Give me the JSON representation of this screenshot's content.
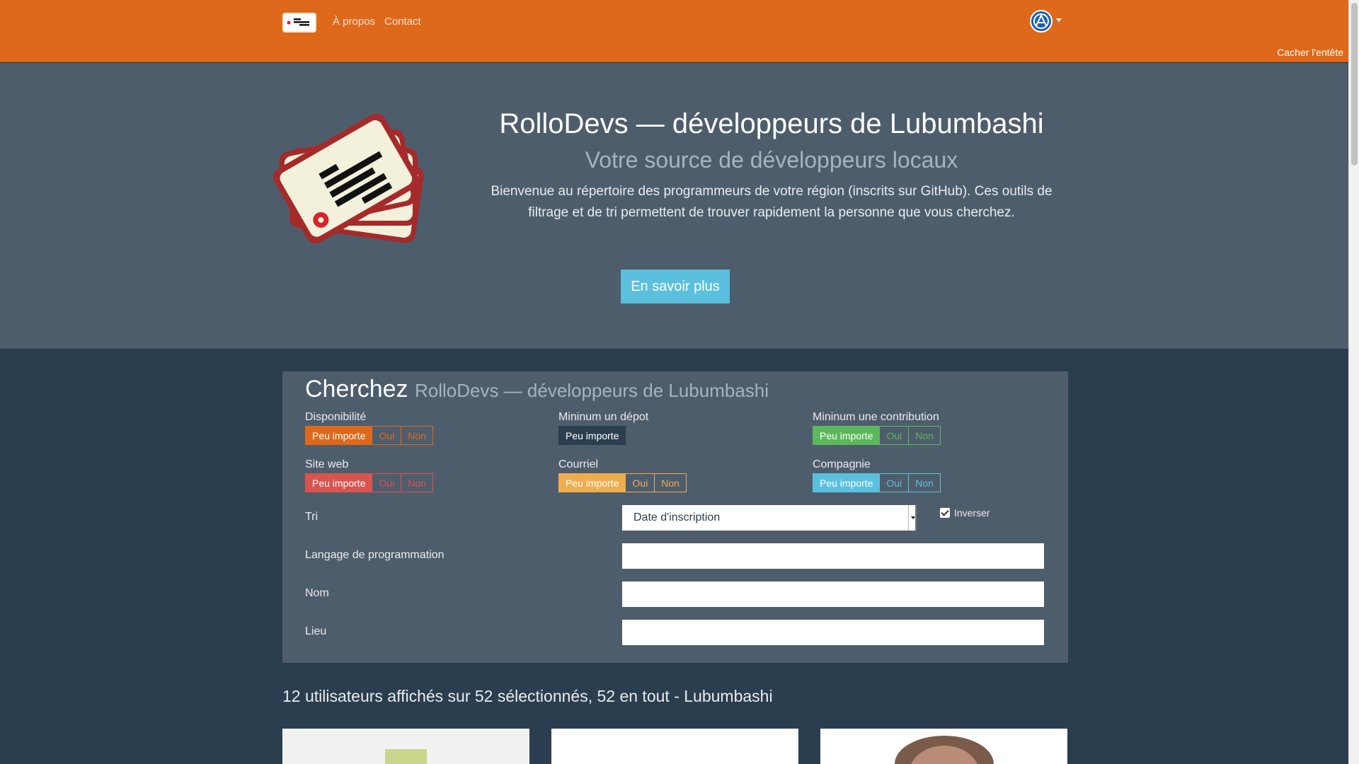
{
  "nav": {
    "about": "À propos",
    "contact": "Contact",
    "hide_header": "Cacher l'entête"
  },
  "hero": {
    "title": "RolloDevs — développeurs de Lubumbashi",
    "subtitle": "Votre source de développeurs locaux",
    "text": "Bienvenue au répertoire des programmeurs de votre région (inscrits sur GitHub). Ces outils de filtrage et de tri permettent de trouver rapidement la personne que vous cherchez.",
    "button": "En savoir plus"
  },
  "search": {
    "title": "Cherchez",
    "title_small": "RolloDevs — développeurs de Lubumbashi",
    "filters": {
      "dispo": {
        "label": "Disponibilité",
        "options": [
          "Peu importe",
          "Oui",
          "Non"
        ]
      },
      "depot": {
        "label": "Mininum un dépot",
        "options": [
          "Peu importe"
        ]
      },
      "contrib": {
        "label": "Mininum une contribution",
        "options": [
          "Peu importe",
          "Oui",
          "Non"
        ]
      },
      "site": {
        "label": "Site web",
        "options": [
          "Peu importe",
          "Oui",
          "Non"
        ]
      },
      "mail": {
        "label": "Courriel",
        "options": [
          "Peu importe",
          "Oui",
          "Non"
        ]
      },
      "comp": {
        "label": "Compagnie",
        "options": [
          "Peu importe",
          "Oui",
          "Non"
        ]
      }
    },
    "sort_label": "Tri",
    "sort_value": "Date d'inscription",
    "inverse_label": "Inverser",
    "language_label": "Langage de programmation",
    "name_label": "Nom",
    "location_label": "Lieu"
  },
  "results": {
    "heading": "12 utilisateurs affichés sur 52 sélectionnés, 52 en tout - Lubumbashi"
  },
  "icons": {
    "brand": "rolodex-card-icon",
    "language": "globe-icon",
    "caret": "caret-down-icon"
  },
  "colors": {
    "navbar": "#df691a",
    "hero": "#4e5d6c",
    "body": "#2b3e50",
    "info": "#5bc0de",
    "danger": "#d9534f",
    "warning": "#f0ad4e",
    "success": "#5cb85c"
  }
}
